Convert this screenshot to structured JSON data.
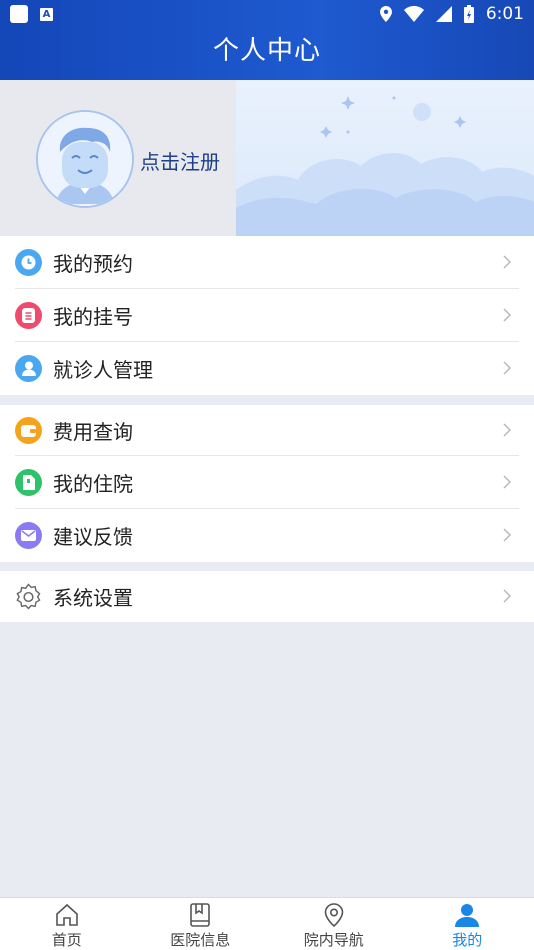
{
  "status_bar": {
    "time": "6:01",
    "icons": [
      "app-square-icon",
      "a-badge-icon",
      "location-icon",
      "wifi-icon",
      "signal-icon",
      "battery-icon"
    ]
  },
  "header": {
    "title": "个人中心"
  },
  "profile": {
    "register_label": "点击注册"
  },
  "menu": {
    "group1": [
      {
        "label": "我的预约",
        "icon": "clock-icon",
        "color": "#4aa8f0"
      },
      {
        "label": "我的挂号",
        "icon": "list-icon",
        "color": "#f04a6e"
      },
      {
        "label": "就诊人管理",
        "icon": "person-icon",
        "color": "#4aa8f0"
      }
    ],
    "group2": [
      {
        "label": "费用查询",
        "icon": "wallet-icon",
        "color": "#f5a31d"
      },
      {
        "label": "我的住院",
        "icon": "hospital-doc-icon",
        "color": "#2ec26a"
      },
      {
        "label": "建议反馈",
        "icon": "mail-icon",
        "color": "#8a7cf0"
      }
    ],
    "group3": [
      {
        "label": "系统设置",
        "icon": "gear-icon",
        "color": "#666666"
      }
    ]
  },
  "tabbar": {
    "tabs": [
      {
        "label": "首页",
        "icon": "home-icon"
      },
      {
        "label": "医院信息",
        "icon": "book-icon"
      },
      {
        "label": "院内导航",
        "icon": "map-pin-icon"
      },
      {
        "label": "我的",
        "icon": "user-icon",
        "active": true
      }
    ]
  },
  "colors": {
    "header_blue": "#1a4fb8",
    "active_tab": "#1a86e8",
    "page_bg": "#e9ebf2"
  }
}
